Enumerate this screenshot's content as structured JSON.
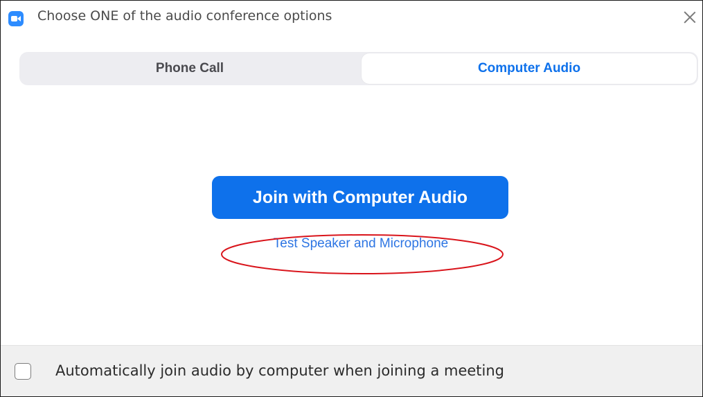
{
  "window": {
    "title": "Choose ONE of the audio conference options",
    "icon": "zoom-camera-icon",
    "close_icon": "close-icon"
  },
  "tabs": [
    {
      "label": "Phone Call",
      "selected": false
    },
    {
      "label": "Computer Audio",
      "selected": true
    }
  ],
  "main": {
    "join_button_label": "Join with Computer Audio",
    "test_link_label": "Test Speaker and Microphone"
  },
  "footer": {
    "auto_join_label": "Automatically join audio by computer when joining a meeting",
    "auto_join_checked": false
  },
  "colors": {
    "accent": "#0e71eb",
    "link": "#2d75e3",
    "annotation": "#d9141b",
    "tab_bg": "#ededf1",
    "footer_bg": "#f0f0f0"
  }
}
